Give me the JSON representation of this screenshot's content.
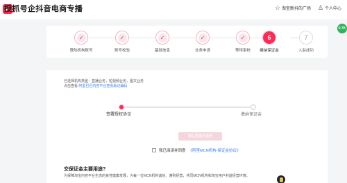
{
  "header": {
    "logo_char": "✔",
    "title": "授抓号企抖音电商专播",
    "right_items": [
      {
        "icon": "star-outline-icon",
        "label": "淘宝新抖的广场"
      },
      {
        "icon": "user-profile-icon",
        "label": "个人中心"
      }
    ],
    "float_badge": "0.7K"
  },
  "steps": [
    {
      "num": "1",
      "label": "登陆机构账号",
      "status": "done"
    },
    {
      "num": "2",
      "label": "账号校验",
      "status": "done"
    },
    {
      "num": "3",
      "label": "基础信息",
      "status": "done"
    },
    {
      "num": "4",
      "label": "业务申请",
      "status": "done"
    },
    {
      "num": "5",
      "label": "等待审核",
      "status": "done"
    },
    {
      "num": "6",
      "label": "缴纳保证金",
      "status": "current"
    },
    {
      "num": "7",
      "label": "入驻成功",
      "status": "todo"
    }
  ],
  "main": {
    "info_line1": "已选择机构类型：直播业务，短视频业务，图文业务",
    "info_line2_prefix": "点击查看",
    "info_line2_link": "阿里巴巴内容平台查看版记编码",
    "sub_steps": [
      "签署授权协议",
      "缴纳保证金"
    ],
    "confirm_button": "确认签署并继续",
    "agree_prefix": "我已阅读并同意",
    "agree_link": "《阿里MCN机构-保证金协议》",
    "faq_title": "交保证金主要用途?",
    "faq_text": "为保障淘宝内容平台生态的良性健康发展，为每一位MCN机构诚信、遵则经营，共同MCN机构和淘宝用户利益经营环境。"
  }
}
